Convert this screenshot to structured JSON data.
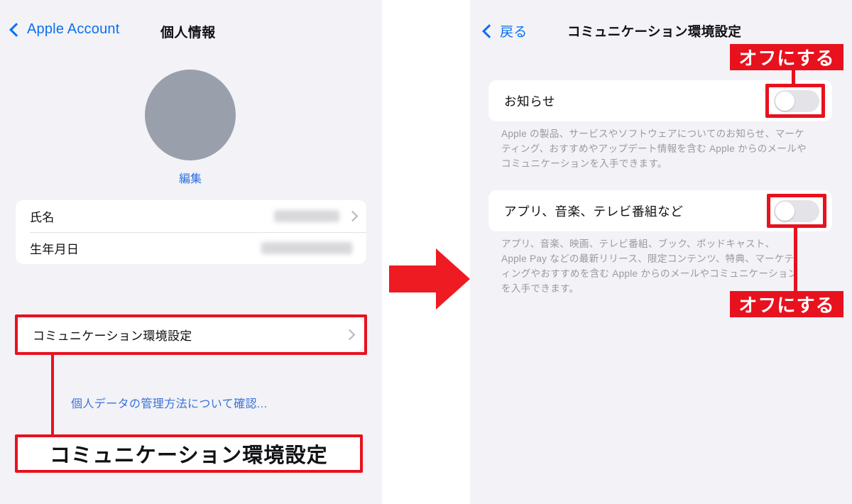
{
  "colors": {
    "accent_red": "#e8111e",
    "ios_blue": "#0a70f0",
    "link_blue": "#2f6fe0",
    "annotation_blue": "#3b72d8",
    "panel_bg": "#f2f2f7",
    "card_bg": "#ffffff",
    "avatar_gray": "#9aa0ab",
    "switch_off_track": "#e4e4e8"
  },
  "left_screen": {
    "nav": {
      "back_label": "Apple Account",
      "title": "個人情報"
    },
    "profile": {
      "edit_label": "編集"
    },
    "identity_rows": [
      {
        "label": "氏名",
        "value": "",
        "redacted": true,
        "has_chevron": true
      },
      {
        "label": "生年月日",
        "value": "",
        "redacted": true,
        "has_chevron": false
      }
    ],
    "comm_row": {
      "label": "コミュニケーション環境設定",
      "has_chevron": true
    }
  },
  "annotations": {
    "blue_note": "個人データの管理方法について確認...",
    "caption": "コミュニケーション環境設定",
    "badge_top": "オフにする",
    "badge_bottom": "オフにする"
  },
  "right_screen": {
    "nav": {
      "back_label": "戻る",
      "title": "コミュニケーション環境設定"
    },
    "sections": [
      {
        "label": "お知らせ",
        "toggle_state": "off",
        "description": "Apple の製品、サービスやソフトウェアについてのお知らせ、マーケティング、おすすめやアップデート情報を含む Apple からのメールやコミュニケーションを入手できます。"
      },
      {
        "label": "アプリ、音楽、テレビ番組など",
        "toggle_state": "off",
        "description": "アプリ、音楽、映画、テレビ番組、ブック、ポッドキャスト、Apple Pay などの最新リリース、限定コンテンツ、特典、マーケティングやおすすめを含む Apple からのメールやコミュニケーションを入手できます。"
      }
    ]
  }
}
